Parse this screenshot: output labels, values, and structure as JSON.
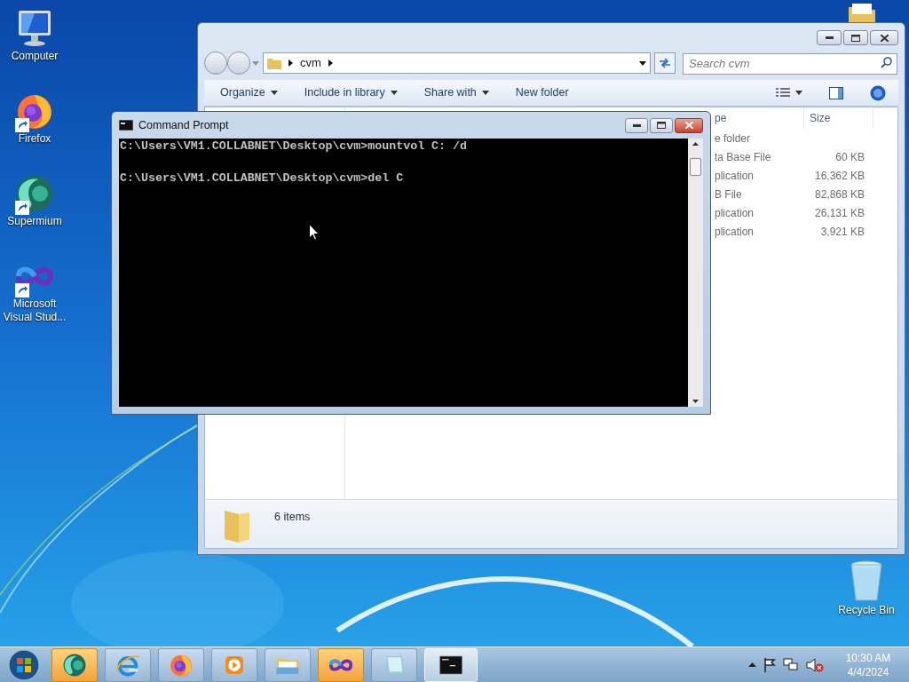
{
  "desktop_icons": [
    {
      "kind": "computer",
      "label": "Computer"
    },
    {
      "kind": "firefox",
      "label": "Firefox"
    },
    {
      "kind": "supermium",
      "label": "Supermium"
    },
    {
      "kind": "visualstudio",
      "label": "Microsoft Visual Stud..."
    }
  ],
  "recycle_bin": {
    "label": "Recycle Bin"
  },
  "explorer": {
    "breadcrumb": [
      "cvm"
    ],
    "search": {
      "placeholder": "Search cvm"
    },
    "toolbar": [
      {
        "label": "Organize",
        "dropdown": true
      },
      {
        "label": "Include in library",
        "dropdown": true
      },
      {
        "label": "Share with",
        "dropdown": true
      },
      {
        "label": "New folder",
        "dropdown": false
      }
    ],
    "columns": [
      "pe",
      "Size"
    ],
    "rows": [
      {
        "type": "e folder"
      },
      {
        "type": "ta Base File",
        "size": "60 KB"
      },
      {
        "type": "plication",
        "size": "16,362 KB"
      },
      {
        "type": "B File",
        "size": "82,868 KB"
      },
      {
        "type": "plication",
        "size": "26,131 KB"
      },
      {
        "type": "plication",
        "size": "3,921 KB"
      }
    ],
    "status": "6 items"
  },
  "cmd": {
    "title": "Command Prompt",
    "lines": [
      "C:\\Users\\VM1.COLLABNET\\Desktop\\cvm>mountvol C: /d",
      "C:\\Users\\VM1.COLLABNET\\Desktop\\cvm>del C"
    ]
  },
  "taskbar": {
    "apps": [
      {
        "kind": "supermium",
        "flashing": true,
        "selected": false
      },
      {
        "kind": "ie",
        "flashing": false,
        "selected": false
      },
      {
        "kind": "firefox",
        "flashing": false,
        "selected": false
      },
      {
        "kind": "media",
        "flashing": false,
        "selected": false
      },
      {
        "kind": "explorer",
        "flashing": false,
        "selected": false
      },
      {
        "kind": "visualstudio",
        "flashing": true,
        "selected": false
      },
      {
        "kind": "notepad",
        "flashing": false,
        "selected": false
      },
      {
        "kind": "cmd",
        "flashing": false,
        "selected": true
      }
    ],
    "volume_muted": true,
    "clock": {
      "time": "10:30 AM",
      "date": "4/4/2024"
    }
  }
}
